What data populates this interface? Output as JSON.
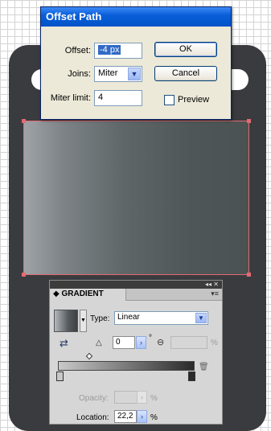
{
  "dialog": {
    "title": "Offset Path",
    "offset_label": "Offset:",
    "offset_value": "-4 px",
    "joins_label": "Joins:",
    "joins_value": "Miter",
    "miter_label": "Miter limit:",
    "miter_value": "4",
    "ok_label": "OK",
    "cancel_label": "Cancel",
    "preview_label": "Preview",
    "preview_checked": false
  },
  "panel": {
    "topstrip_controls": "◂◂ ✕",
    "title": "GRADIENT",
    "type_label": "Type:",
    "type_value": "Linear",
    "angle_value": "0",
    "angle_unit": "°",
    "aspect_unit": "%",
    "opacity_label": "Opacity:",
    "opacity_unit": "%",
    "location_label": "Location:",
    "location_value": "22,2",
    "location_unit": "%"
  },
  "colors": {
    "selection": "#e46a72",
    "artwork": "#3a3b3e",
    "dialog_title": "#0a5fd8"
  }
}
